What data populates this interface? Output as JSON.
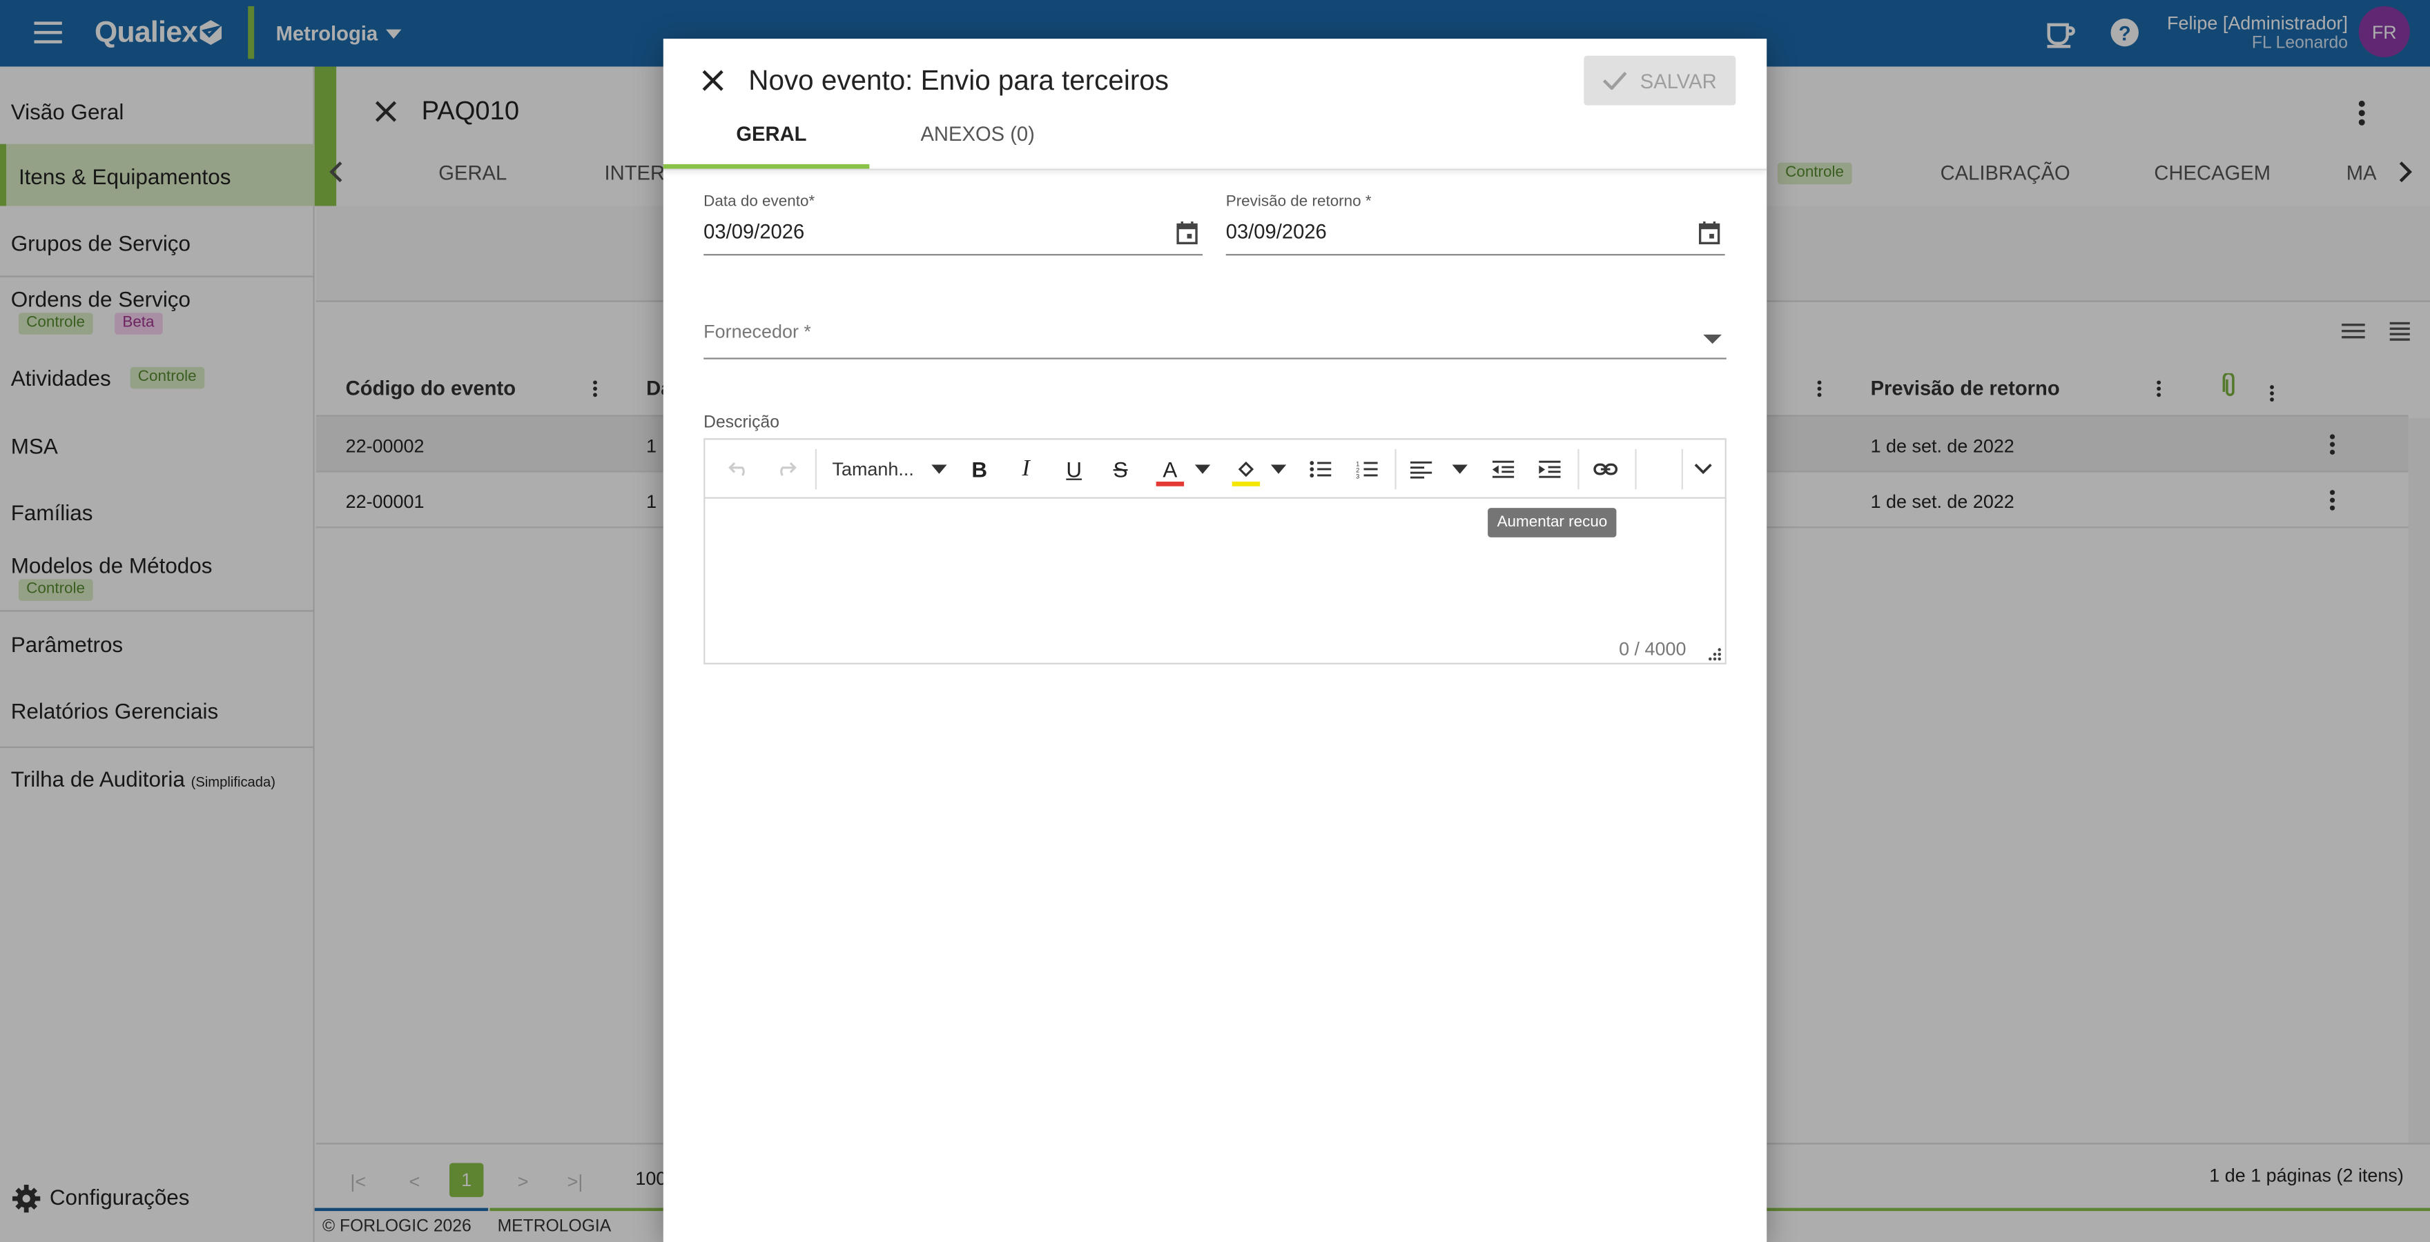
{
  "topbar": {
    "brand": "Qualiex",
    "module": "Metrologia",
    "user_name": "Felipe [Administrador]",
    "user_org": "FL Leonardo",
    "avatar": "FR",
    "icons": [
      "menu-icon",
      "logo-icon",
      "chevron-down-icon",
      "coffee-cup-icon",
      "help-icon"
    ]
  },
  "sidebar": {
    "items": [
      {
        "label": "Visão Geral"
      },
      {
        "label": "Itens & Equipamentos"
      },
      {
        "label": "Grupos de Serviço"
      },
      {
        "label": "Ordens de Serviço",
        "tags": [
          "Controle",
          "Beta"
        ]
      },
      {
        "label": "Atividades",
        "tags": [
          "Controle"
        ]
      },
      {
        "label": "MSA"
      },
      {
        "label": "Famílias"
      },
      {
        "label": "Modelos de Métodos",
        "tags": [
          "Controle"
        ]
      },
      {
        "label": "Parâmetros"
      },
      {
        "label": "Relatórios Gerenciais"
      },
      {
        "label": "Trilha de Auditoria",
        "suffix": "(Simplificada)"
      }
    ],
    "settings_label": "Configurações"
  },
  "page": {
    "code": "PAQ010",
    "tabs": [
      "GERAL",
      "INTERV",
      "Controle",
      "CALIBRAÇÃO",
      "CHECAGEM",
      "MA"
    ],
    "table": {
      "headers": [
        "Código do evento",
        "Da",
        "Previsão de retorno"
      ],
      "rows": [
        {
          "code": "22-00002",
          "date": "1",
          "return": "1 de set. de 2022"
        },
        {
          "code": "22-00001",
          "date": "1",
          "return": "1 de set. de 2022"
        }
      ]
    },
    "pagination": {
      "current": "1",
      "page_size": "100",
      "summary": "1 de 1 páginas (2 itens)"
    },
    "footer": {
      "copyright": "© FORLOGIC 2026",
      "module": "METROLOGIA"
    }
  },
  "dialog": {
    "title": "Novo evento: Envio para terceiros",
    "save_label": "SALVAR",
    "tabs": [
      {
        "label": "GERAL",
        "active": true
      },
      {
        "label": "ANEXOS (0)",
        "active": false
      }
    ],
    "fields": {
      "event_date_label": "Data do evento*",
      "event_date_value": "03/09/2026",
      "return_label": "Previsão de retorno *",
      "return_value": "03/09/2026",
      "supplier_label": "Fornecedor *",
      "description_label": "Descrição"
    },
    "editor": {
      "font_size_label": "Tamanh...",
      "counter": "0 / 4000",
      "tooltip": "Aumentar recuo"
    }
  },
  "colors": {
    "topbar": "#1c6aad",
    "accent_green": "#8bc34a",
    "avatar": "#8e3aa8"
  }
}
